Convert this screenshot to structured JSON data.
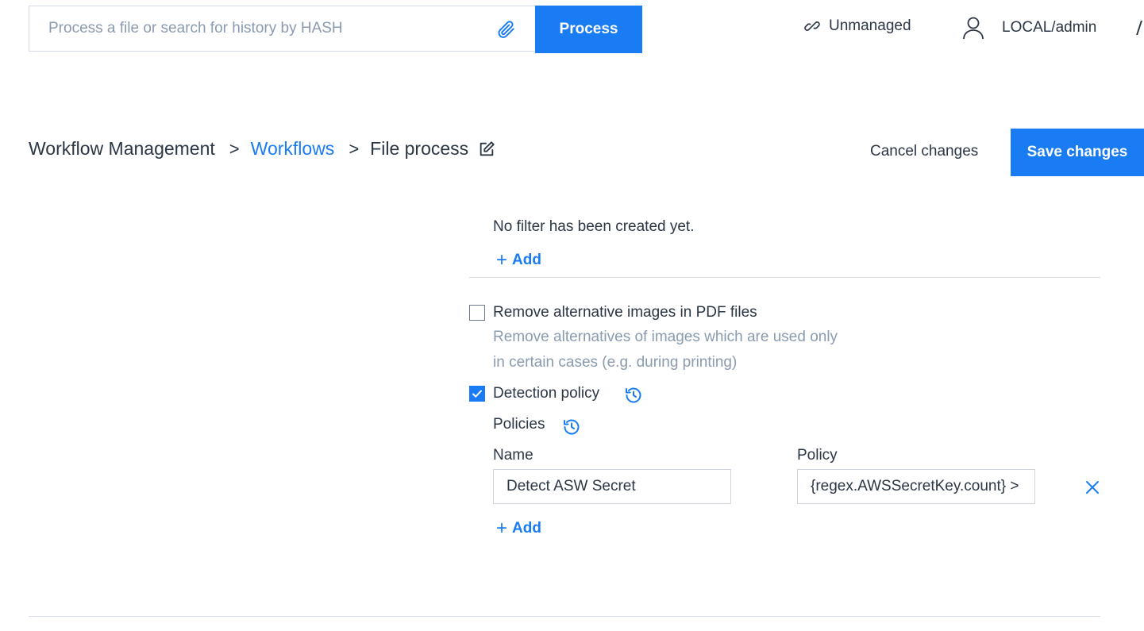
{
  "topbar": {
    "search_placeholder": "Process a file or search for history by HASH",
    "search_value": "",
    "attach_icon": "paperclip-icon",
    "process_label": "Process",
    "unmanaged_label": "Unmanaged",
    "unmanaged_icon": "unlink-icon",
    "user_label": "LOCAL/admin",
    "user_icon": "user-icon"
  },
  "breadcrumb": {
    "root": "Workflow Management",
    "link": "Workflows",
    "current": "File process",
    "separator": ">",
    "edit_icon": "pencil-edit-icon"
  },
  "actions": {
    "cancel_label": "Cancel changes",
    "save_label": "Save changes"
  },
  "filters": {
    "empty_text": "No filter has been created yet.",
    "add_label": "Add"
  },
  "options": {
    "remove_alt_images": {
      "title": "Remove alternative images in PDF files",
      "description": "Remove alternatives of images which are used only in certain cases (e.g. during printing)",
      "checked": false
    },
    "detection_policy": {
      "title": "Detection policy",
      "checked": true,
      "history_icon": "history-icon"
    }
  },
  "policies": {
    "title": "Policies",
    "history_icon": "history-icon",
    "columns": {
      "name": "Name",
      "policy": "Policy"
    },
    "rows": [
      {
        "name": "Detect ASW Secret",
        "policy": "{regex.AWSSecretKey.count} >"
      }
    ],
    "add_label": "Add",
    "remove_icon": "close-icon"
  },
  "colors": {
    "accent": "#1a7cf3",
    "text": "#2b3645",
    "muted": "#8a9bb0",
    "border": "#d5dbe3"
  }
}
